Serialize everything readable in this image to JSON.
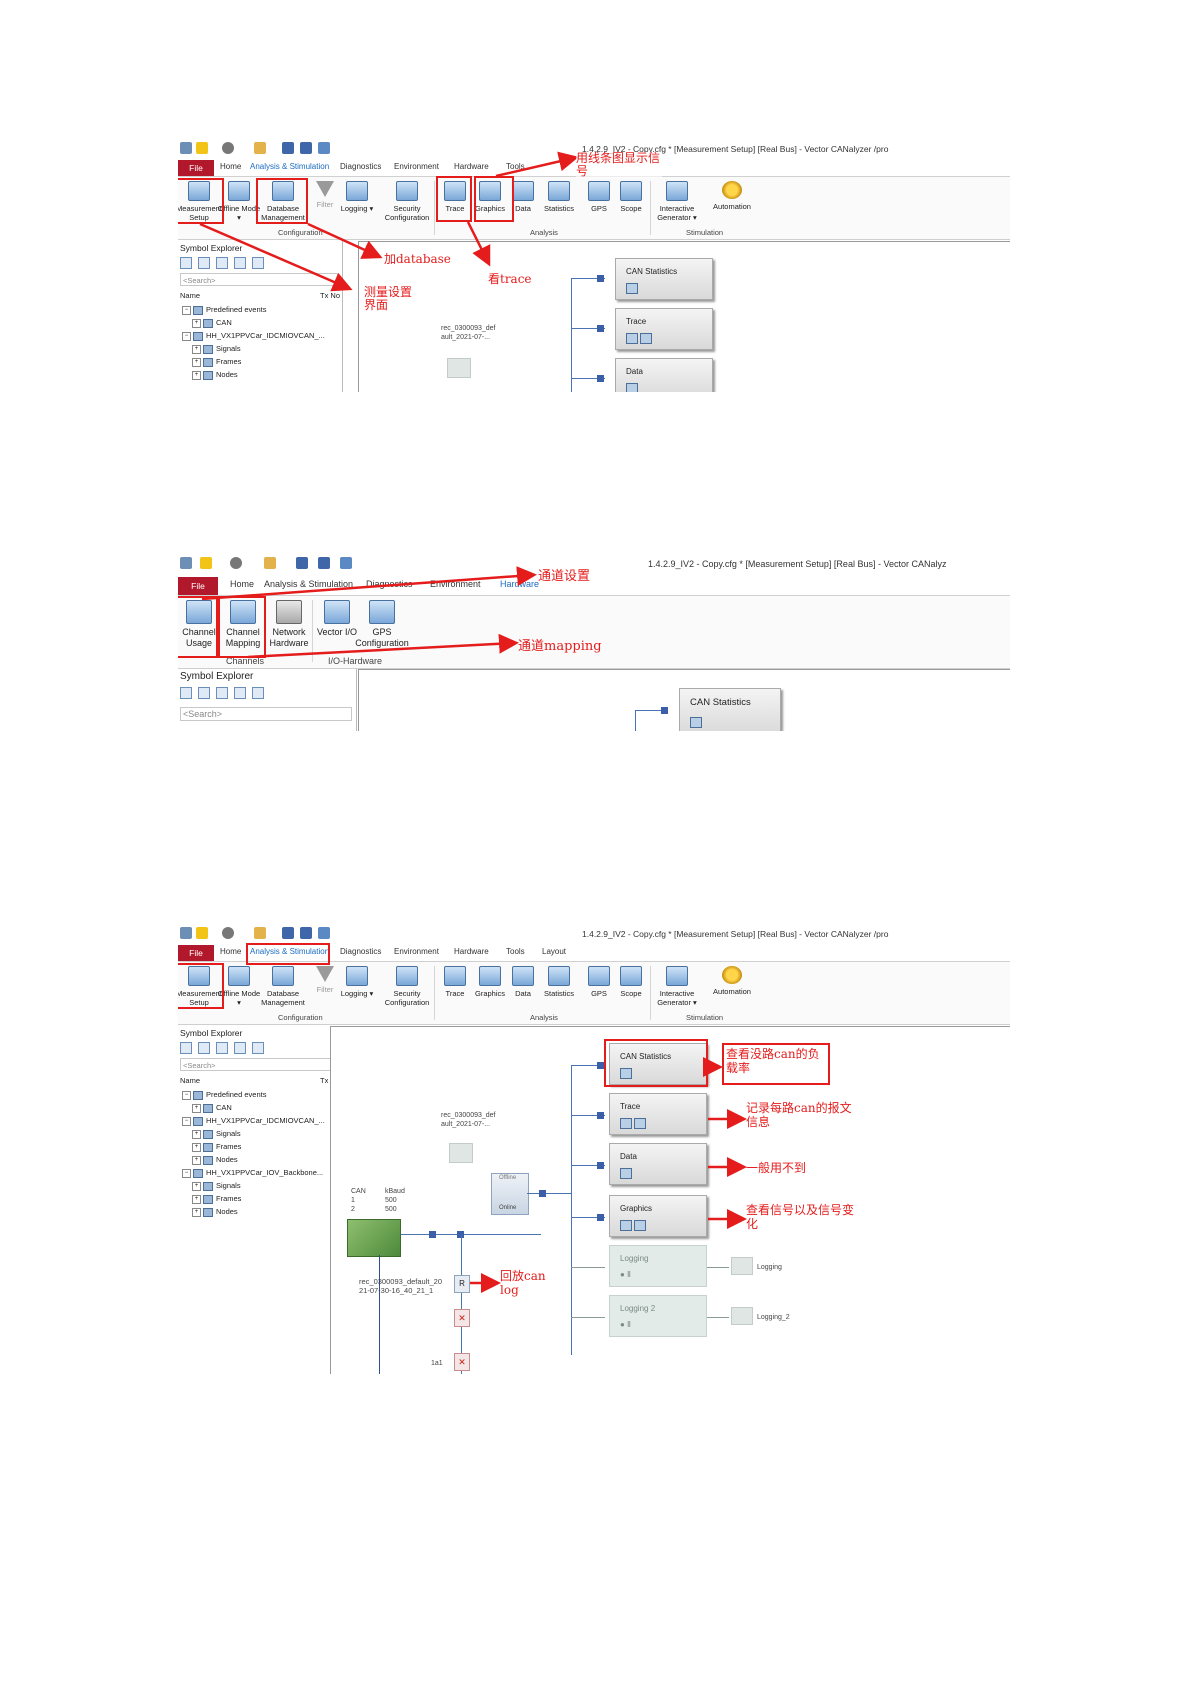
{
  "colors": {
    "file_tab": "#b2182b",
    "accent_blue": "#1a6cc2",
    "annotation_red": "#e51c1c",
    "connector": "#3a5fa8"
  },
  "window_title": "1.4.2.9_IV2 - Copy.cfg * [Measurement Setup] [Real Bus] - Vector CANalyzer /pro",
  "window_title_short": "1.4.2.9_IV2 - Copy.cfg * [Measurement Setup] [Real Bus] - Vector CANalyz",
  "tabs": {
    "file": "File",
    "home": "Home",
    "analysis": "Analysis & Stimulation",
    "diagnostics": "Diagnostics",
    "environment": "Environment",
    "hardware": "Hardware",
    "tools": "Tools",
    "layout": "Layout"
  },
  "ribbon": {
    "measurement_setup": "Measurement Setup",
    "offline_mode": "Offline Mode ▾",
    "database_management": "Database Management",
    "filter": "Filter",
    "logging": "Logging ▾",
    "security_configuration": "Security Configuration",
    "trace": "Trace",
    "graphics": "Graphics",
    "data": "Data",
    "statistics": "Statistics",
    "gps": "GPS",
    "scope": "Scope",
    "interactive_generator": "Interactive Generator ▾",
    "automation": "Automation",
    "group_configuration": "Configuration",
    "group_analysis": "Analysis",
    "group_stimulation": "Stimulation"
  },
  "hw_ribbon": {
    "channel_usage": "Channel Usage",
    "channel_mapping": "Channel Mapping",
    "network_hardware": "Network Hardware",
    "vector_io": "Vector I/O",
    "gps_configuration": "GPS Configuration",
    "group_channels": "Channels",
    "group_io": "I/O-Hardware"
  },
  "symbol_explorer": {
    "title": "Symbol Explorer",
    "search": "<Search>",
    "col_name": "Name",
    "col_txno": "Tx No",
    "tree": [
      "Predefined events",
      "CAN",
      "HH_VX1PPVCar_IDCMIOVCAN_...",
      "Signals",
      "Frames",
      "Nodes",
      "HH_VX1PPVCar_IOV_Backbone...",
      "Signals",
      "Frames",
      "Nodes"
    ]
  },
  "canvas": {
    "rec_file_short": "rec_0300093_def ault_2021-07-...",
    "rec_file_long": "rec_0300093_default_20 21-07-30-16_40_21_1",
    "can_hdr": "CAN",
    "kbaud_hdr": "kBaud",
    "ch1": "1",
    "ch2": "2",
    "baud1": "500",
    "baud2": "500",
    "offline": "Offline",
    "online": "Online",
    "r": "R",
    "label_1a1": "1a1",
    "blocks": {
      "can_statistics": "CAN Statistics",
      "trace": "Trace",
      "data": "Data",
      "graphics": "Graphics",
      "logging": "Logging",
      "logging2": "Logging 2"
    },
    "logging_out": "Logging",
    "logging2_out": "Logging_2"
  },
  "annotations": {
    "graphics_note": "用线条图显示信号",
    "add_database": "加database",
    "view_trace": "看trace",
    "measurement_setup_note": "测量设置界面",
    "channel_setting": "通道设置",
    "channel_mapping": "通道mapping",
    "can_load": "查看没路can的负载率",
    "record_messages": "记录每路can的报文信息",
    "rarely_used": "一般用不到",
    "view_signals": "查看信号以及信号变化",
    "replay_log": "回放can log"
  }
}
